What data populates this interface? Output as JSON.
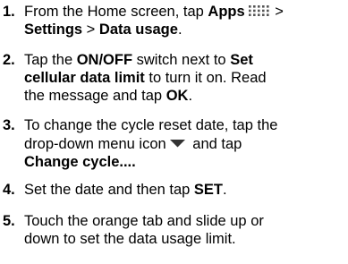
{
  "steps": [
    {
      "number": "1.",
      "line1": {
        "t1": "From the Home screen, tap ",
        "b1": "Apps",
        "t2": " >"
      },
      "line2": {
        "b1": "Settings",
        "t1": " > ",
        "b2": "Data usage",
        "t2": "."
      },
      "icon": "apps-grid-icon"
    },
    {
      "number": "2.",
      "line1": {
        "t1": "Tap the ",
        "b1": "ON/OFF",
        "t2": " switch next to ",
        "b2": "Set"
      },
      "line2": {
        "b1": "cellular data limit",
        "t1": " to turn it on. Read"
      },
      "line3": {
        "t1": "the message and tap ",
        "b1": "OK",
        "t2": "."
      }
    },
    {
      "number": "3.",
      "line1": {
        "t1": "To change the cycle reset date, tap the"
      },
      "line2": {
        "t1": "drop-down menu icon",
        "t2": " and tap"
      },
      "line3": {
        "b1": "Change cycle...",
        "t1": "."
      },
      "icon": "dropdown-triangle-icon"
    },
    {
      "number": "4.",
      "line1": {
        "t1": "Set the date and then tap ",
        "b1": "SET",
        "t2": "."
      }
    },
    {
      "number": "5.",
      "line1": {
        "t1": "Touch the orange tab and slide up or"
      },
      "line2": {
        "t1": "down to set the data usage limit."
      }
    }
  ]
}
